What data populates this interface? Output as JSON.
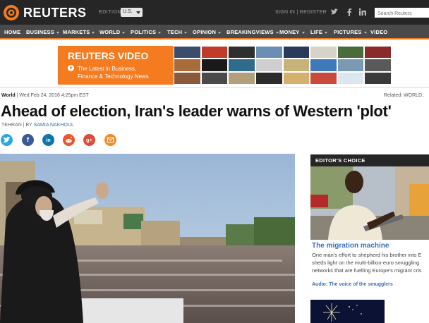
{
  "header": {
    "brand": "REUTERS",
    "edition_label": "EDITION:",
    "edition_value": "U.S.",
    "signin_label": "SIGN IN | REGISTER",
    "search_placeholder": "Search Reuters"
  },
  "nav": {
    "items": [
      "HOME",
      "BUSINESS",
      "MARKETS",
      "WORLD",
      "POLITICS",
      "TECH",
      "OPINION",
      "BREAKINGVIEWS",
      "MONEY",
      "LIFE",
      "PICTURES",
      "VIDEO"
    ]
  },
  "ad": {
    "title": "REUTERS VIDEO",
    "line1": "The Latest in Business,",
    "line2": "Finance & Technology News",
    "accent": "#f47b20"
  },
  "article": {
    "section": "World",
    "date": "Wed Feb 24, 2016 4:25pm EST",
    "related": "Related: WORLD,",
    "headline": "Ahead of election, Iran's leader warns of Western 'plot'",
    "dateline": "TEHRAN | BY",
    "author": "SAMIA NAKHOUL"
  },
  "share_icons": [
    {
      "name": "twitter-icon",
      "glyph": "t",
      "color": "#2aa9e0"
    },
    {
      "name": "facebook-icon",
      "glyph": "f",
      "color": "#3b5998"
    },
    {
      "name": "linkedin-icon",
      "glyph": "in",
      "color": "#0e76a8"
    },
    {
      "name": "reddit-icon",
      "glyph": "r",
      "color": "#e8572c"
    },
    {
      "name": "google-plus-icon",
      "glyph": "g+",
      "color": "#dd4b39"
    },
    {
      "name": "email-icon",
      "glyph": "✉",
      "color": "#f58a25"
    }
  ],
  "editors_choice": {
    "header": "EDITOR'S CHOICE",
    "title": "The migration machine",
    "body1": "One man's effort to shepherd his brother into E",
    "body2": "sheds light on the multi-billion-euro smuggling",
    "body3": "networks that are fuelling Europe's migrant cris",
    "audio": "Audio: The voice of the smugglers"
  }
}
